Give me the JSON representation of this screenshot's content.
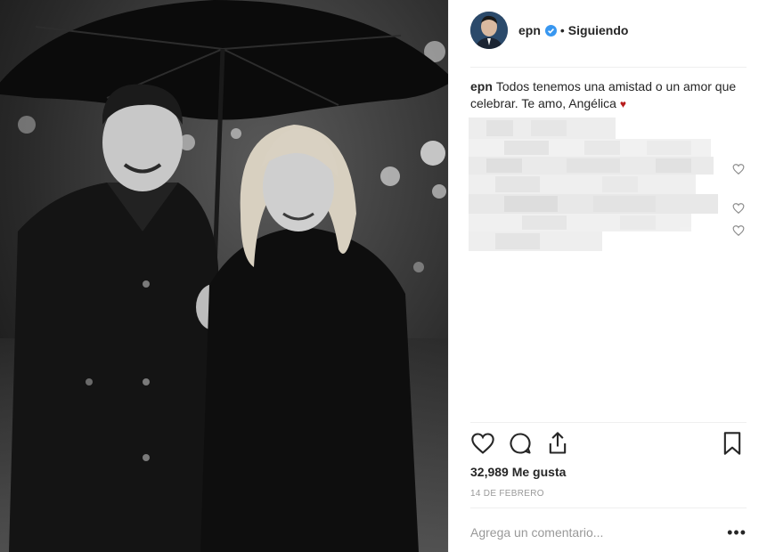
{
  "post": {
    "username": "epn",
    "separator": "•",
    "follow_status": "Siguiendo",
    "caption_user": "epn",
    "caption_text": "Todos tenemos una amistad o un amor que celebrar. Te amo, Angélica",
    "caption_emoji": "♥",
    "likes": "32,989 Me gusta",
    "date": "14 DE FEBRERO",
    "comment_placeholder": "Agrega un comentario...",
    "more_label": "•••"
  },
  "colors": {
    "verified": "#3897f0",
    "heart_emoji": "#b71c1c",
    "muted_text": "#999999"
  },
  "icons": [
    "verified-badge-icon",
    "like-icon",
    "comment-icon",
    "share-icon",
    "save-icon",
    "more-options-icon"
  ]
}
